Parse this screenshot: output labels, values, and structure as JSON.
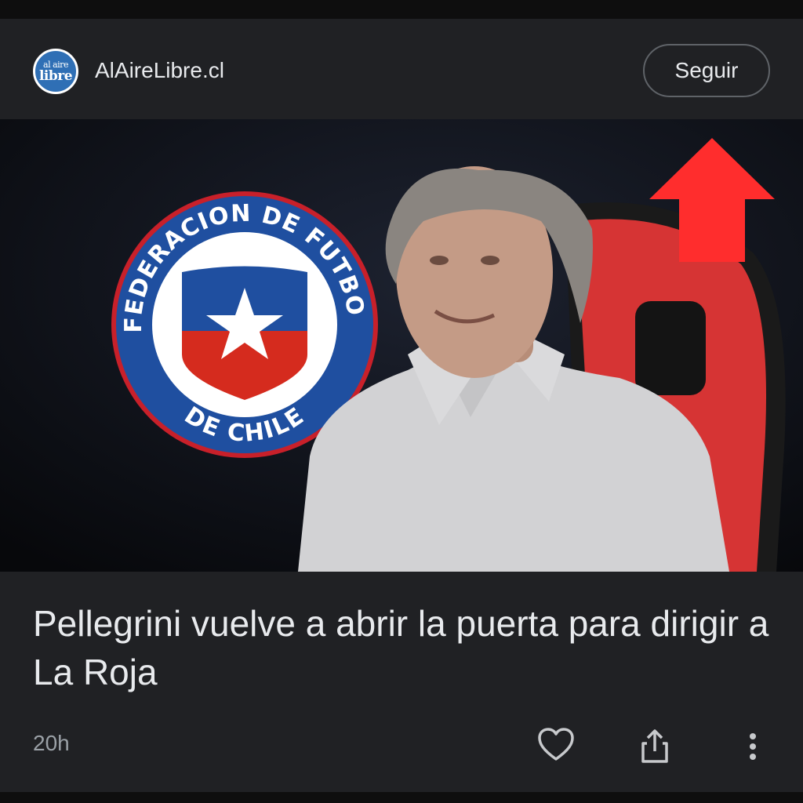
{
  "source": {
    "name": "AlAireLibre.cl",
    "logo_top": "al aire",
    "logo_bottom": "libre"
  },
  "follow_button": {
    "label": "Seguir"
  },
  "article": {
    "image_badge": {
      "top_text": "FEDERACION DE FUTBOL",
      "bottom_text": "DE CHILE"
    },
    "headline": "Pellegrini vuelve a abrir la puerta para dirigir a La Roja",
    "age": "20h"
  },
  "actions": {
    "like_icon": "heart-icon",
    "share_icon": "share-icon",
    "more_icon": "more-vert-icon"
  },
  "colors": {
    "background": "#202124",
    "text": "#e8eaed",
    "muted": "#9aa0a6",
    "annotation_arrow": "#ff2d2d",
    "badge_blue": "#1f4fa0",
    "badge_red": "#d52b1e"
  }
}
